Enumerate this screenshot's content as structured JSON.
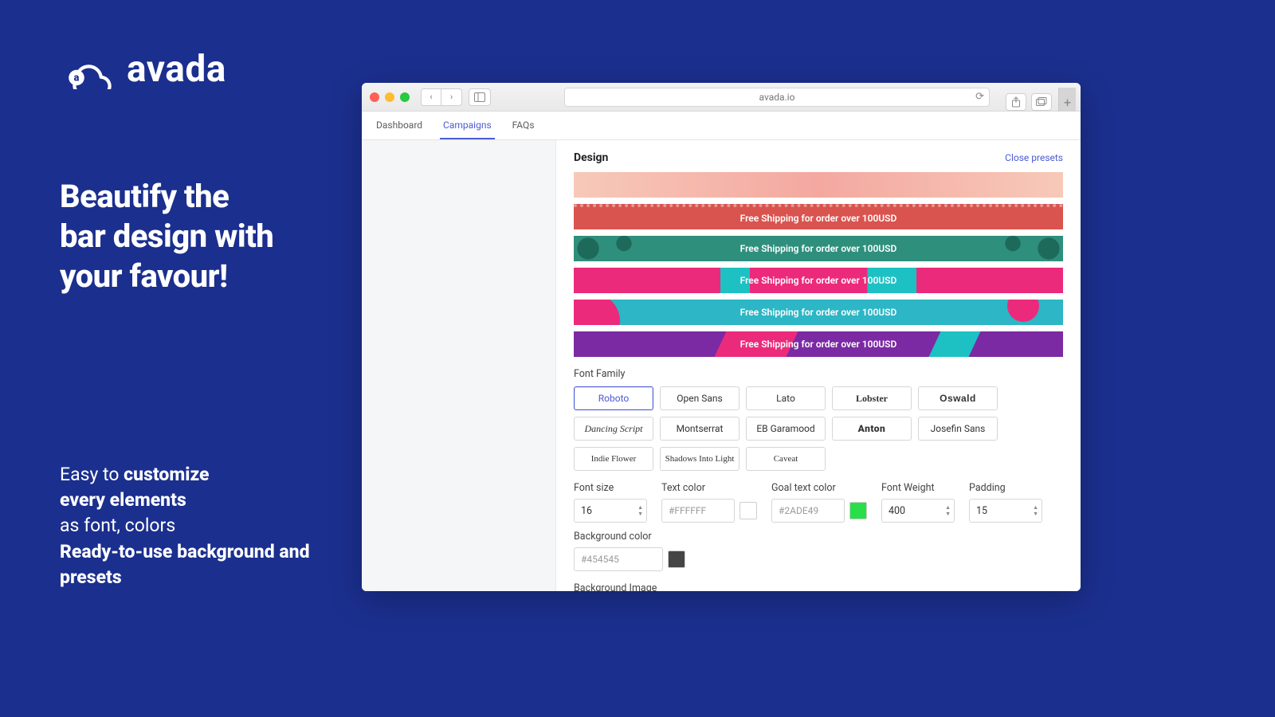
{
  "brand": {
    "name": "avada"
  },
  "marketing": {
    "headline": "Beautify the bar design with your favour!",
    "sub_html_parts": [
      {
        "t": "Easy to ",
        "b": false
      },
      {
        "t": "customize every elements",
        "b": true
      },
      {
        "t": " as font, colors",
        "b": false
      },
      {
        "t": "\nReady-to-use background and presets",
        "b": true
      }
    ]
  },
  "browser": {
    "address": "avada.io"
  },
  "tabs": [
    "Dashboard",
    "Campaigns",
    "FAQs"
  ],
  "active_tab_index": 1,
  "panel": {
    "title": "Design",
    "close_label": "Close presets",
    "bars": [
      {
        "style": "peach",
        "text": ""
      },
      {
        "style": "red",
        "text": "Free Shipping for order over 100USD"
      },
      {
        "style": "green",
        "text": "Free Shipping for order over 100USD"
      },
      {
        "style": "magenta",
        "text": "Free Shipping for order over 100USD"
      },
      {
        "style": "cyan",
        "text": "Free Shipping for order over 100USD"
      },
      {
        "style": "purple",
        "text": "Free Shipping for order over 100USD"
      }
    ],
    "font_family": {
      "label": "Font Family",
      "options": [
        {
          "name": "Roboto",
          "cls": "",
          "selected": true
        },
        {
          "name": "Open Sans",
          "cls": ""
        },
        {
          "name": "Lato",
          "cls": ""
        },
        {
          "name": "Lobster",
          "cls": "lobster"
        },
        {
          "name": "Oswald",
          "cls": "oswald"
        },
        {
          "name": "Dancing Script",
          "cls": "script"
        },
        {
          "name": "Montserrat",
          "cls": ""
        },
        {
          "name": "EB Garamood",
          "cls": ""
        },
        {
          "name": "Anton",
          "cls": "anton"
        },
        {
          "name": "Josefin Sans",
          "cls": ""
        },
        {
          "name": "Indie Flower",
          "cls": "hand"
        },
        {
          "name": "Shadows Into Light",
          "cls": "hand"
        },
        {
          "name": "Caveat",
          "cls": "hand"
        }
      ]
    },
    "fields": {
      "font_size": {
        "label": "Font size",
        "value": "16"
      },
      "text_color": {
        "label": "Text color",
        "value": "#FFFFFF",
        "swatch": "#ffffff"
      },
      "goal_color": {
        "label": "Goal text color",
        "value": "#2ADE49",
        "swatch": "#2ade49"
      },
      "font_weight": {
        "label": "Font Weight",
        "value": "400"
      },
      "padding": {
        "label": "Padding",
        "value": "15"
      },
      "bg_color": {
        "label": "Background color",
        "value": "#454545",
        "swatch": "#454545"
      }
    },
    "bg_image_label": "Background Image",
    "bg_thumbs_row1": [
      {
        "type": "none"
      },
      {
        "color": "#e06a60"
      },
      {
        "color": "#e06a60"
      },
      {
        "color": "#e06a60"
      },
      {
        "color": "#54a8e0"
      },
      {
        "color": "#f4c6bb"
      },
      {
        "color": "#d9544f"
      },
      {
        "color": "#2f8f7d"
      },
      {
        "color": "#ec2a7b"
      },
      {
        "color": "#2db6c5"
      },
      {
        "color": "#7b2aa3"
      },
      {
        "color": "#f2d13a"
      },
      {
        "color": "#f6f2de"
      },
      {
        "color": "#cfd98c"
      }
    ],
    "bg_thumbs_row2": [
      {
        "color": "#e8b13a"
      },
      {
        "color": "#1a3a2a"
      },
      {
        "color": "#f08a2c"
      },
      {
        "color": "#3a3ae0"
      },
      {
        "color": "#ffffff",
        "outlined": true
      },
      {
        "color": "#6a4a9a"
      },
      {
        "color": "#a7825a"
      },
      {
        "color": "#2a2a2a"
      },
      {
        "type": "dashed"
      }
    ]
  }
}
